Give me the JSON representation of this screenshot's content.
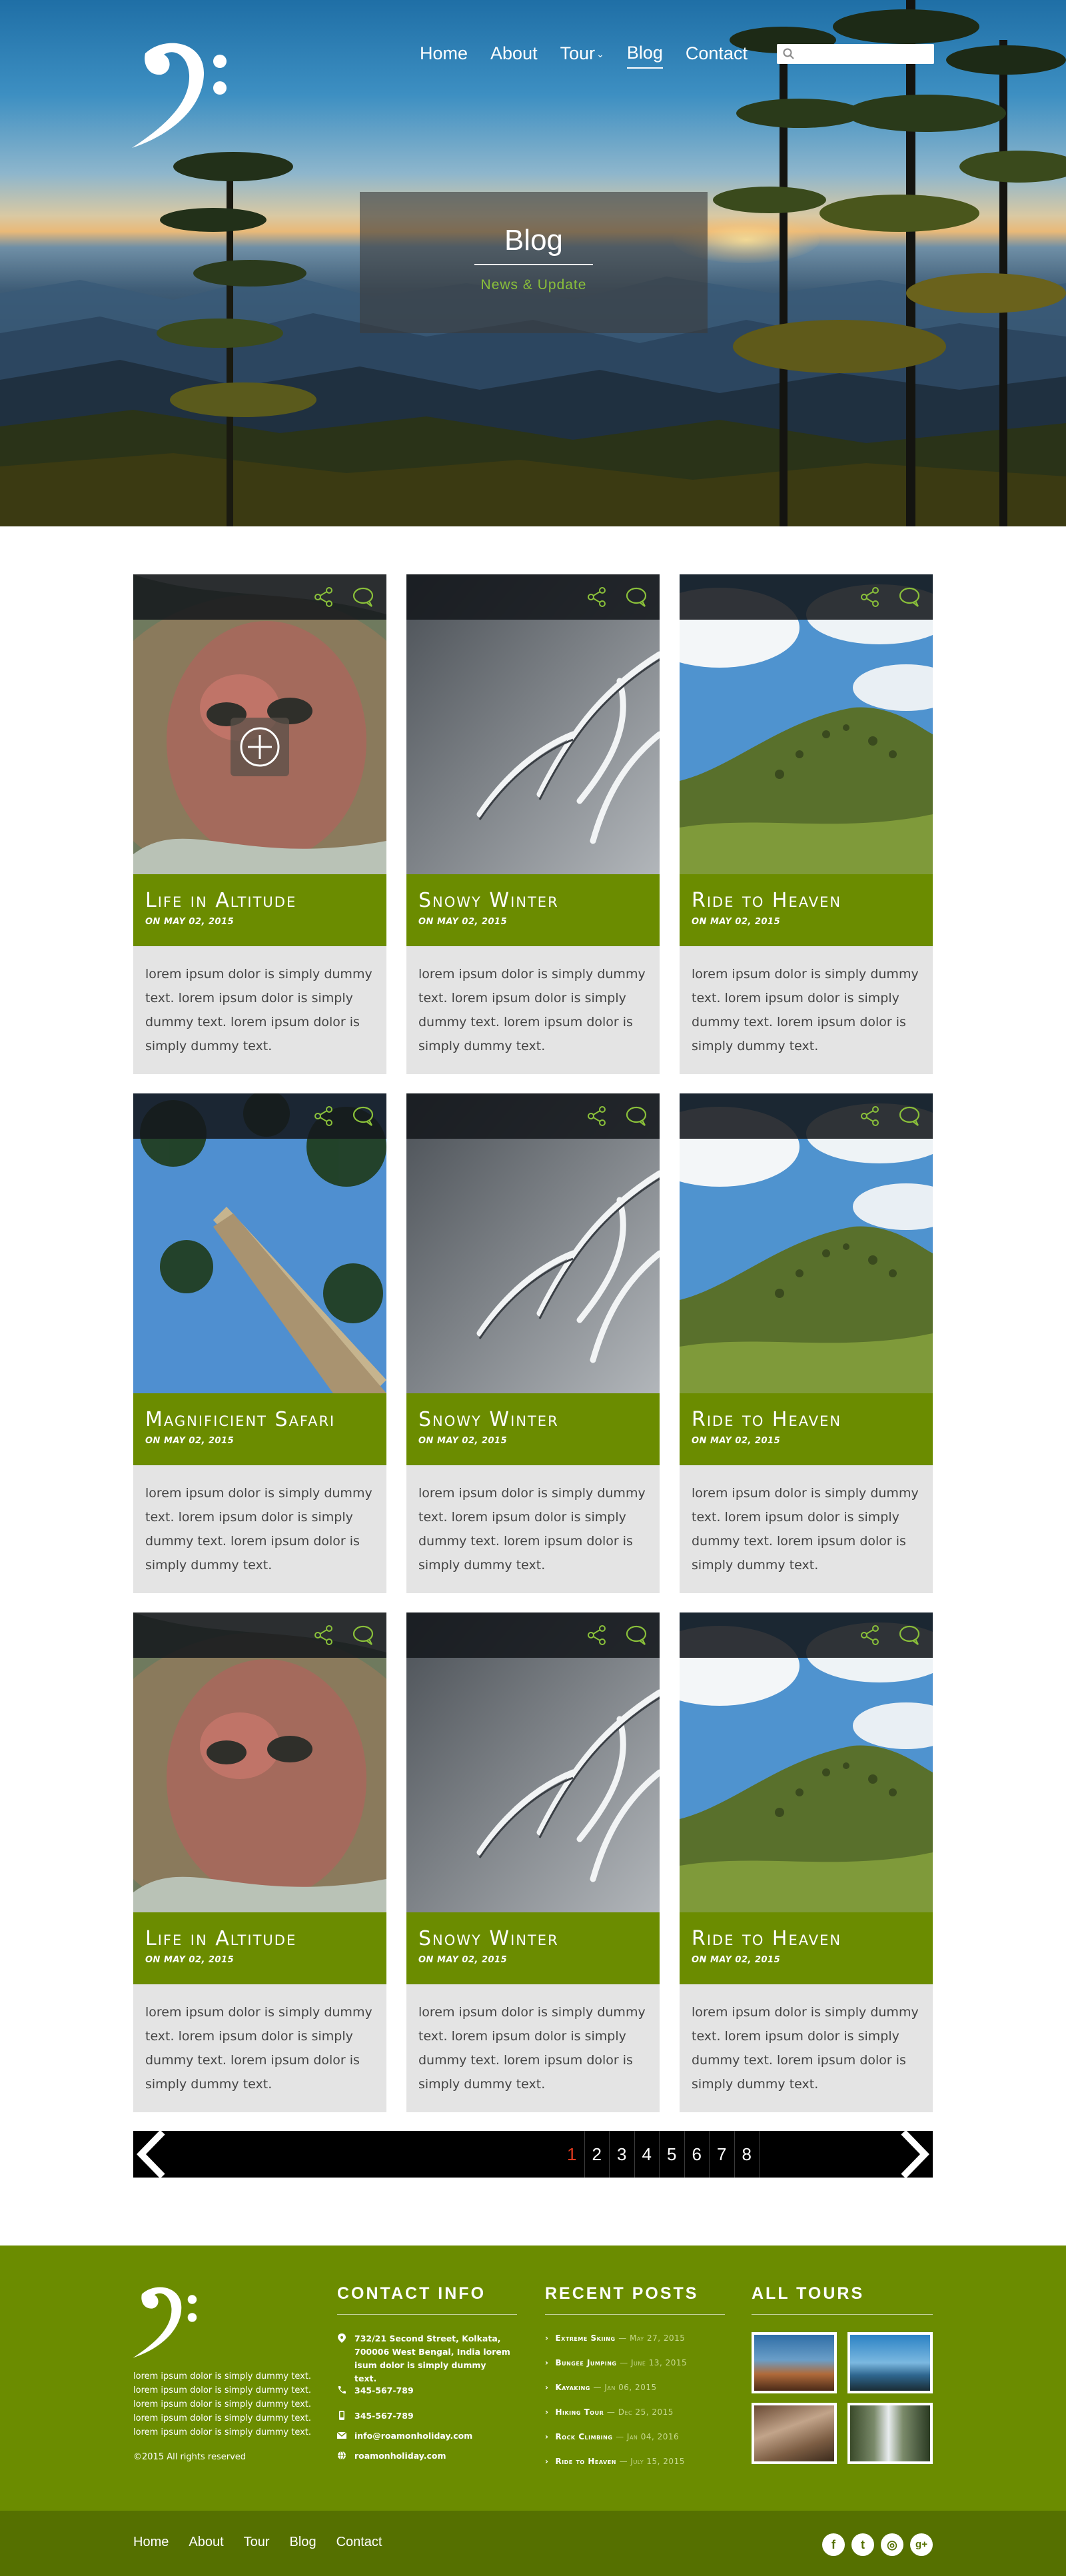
{
  "nav": {
    "items": [
      {
        "label": "Home"
      },
      {
        "label": "About"
      },
      {
        "label": "Tour"
      },
      {
        "label": "Blog"
      },
      {
        "label": "Contact"
      }
    ],
    "search_placeholder": ""
  },
  "hero": {
    "title": "Blog",
    "subtitle": "News & Update"
  },
  "posts": [
    {
      "title": "Life in Altitude",
      "date": "ON MAY 02, 2015",
      "excerpt": "lorem ipsum dolor is simply dummy text. lorem ipsum dolor is simply dummy text. lorem ipsum dolor is simply dummy text.",
      "image": "child-portrait"
    },
    {
      "title": "Snowy Winter",
      "date": "ON MAY 02, 2015",
      "excerpt": "lorem ipsum dolor is simply dummy text. lorem ipsum dolor is simply dummy text. lorem ipsum dolor is simply dummy text.",
      "image": "snowy-branches"
    },
    {
      "title": "Ride to Heaven",
      "date": "ON MAY 02, 2015",
      "excerpt": "lorem ipsum dolor is simply dummy text. lorem ipsum dolor is simply dummy text. lorem ipsum dolor is simply dummy text.",
      "image": "green-hill"
    },
    {
      "title": "Magnificient Safari",
      "date": "ON MAY 02, 2015",
      "excerpt": "lorem ipsum dolor is simply dummy text. lorem ipsum dolor is simply dummy text. lorem ipsum dolor is simply dummy text.",
      "image": "tree-trunk-sky"
    },
    {
      "title": "Snowy Winter",
      "date": "ON MAY 02, 2015",
      "excerpt": "lorem ipsum dolor is simply dummy text. lorem ipsum dolor is simply dummy text. lorem ipsum dolor is simply dummy text.",
      "image": "snowy-branches"
    },
    {
      "title": "Ride to Heaven",
      "date": "ON MAY 02, 2015",
      "excerpt": "lorem ipsum dolor is simply dummy text. lorem ipsum dolor is simply dummy text. lorem ipsum dolor is simply dummy text.",
      "image": "green-hill"
    },
    {
      "title": "Life in Altitude",
      "date": "ON MAY 02, 2015",
      "excerpt": "lorem ipsum dolor is simply dummy text. lorem ipsum dolor is simply dummy text. lorem ipsum dolor is simply dummy text.",
      "image": "child-portrait"
    },
    {
      "title": "Snowy Winter",
      "date": "ON MAY 02, 2015",
      "excerpt": "lorem ipsum dolor is simply dummy text. lorem ipsum dolor is simply dummy text. lorem ipsum dolor is simply dummy text.",
      "image": "snowy-branches"
    },
    {
      "title": "Ride to Heaven",
      "date": "ON MAY 02, 2015",
      "excerpt": "lorem ipsum dolor is simply dummy text. lorem ipsum dolor is simply dummy text. lorem ipsum dolor is simply dummy text.",
      "image": "green-hill"
    }
  ],
  "card_icons": {
    "share": "share-icon",
    "comment": "comment-icon",
    "zoom": "plus-circle-icon"
  },
  "pagination": {
    "pages": [
      "1",
      "2",
      "3",
      "4",
      "5",
      "6",
      "7",
      "8"
    ],
    "current": "1",
    "prev_icon": "chevron-left-icon",
    "next_icon": "chevron-right-icon"
  },
  "footer": {
    "about": "lorem ipsum dolor is simply dummy text. lorem ipsum dolor is simply dummy text. lorem ipsum dolor is simply dummy text. lorem ipsum dolor is simply dummy text. lorem ipsum dolor is simply dummy text.",
    "copyright": "©2015 All rights reserved",
    "contact": {
      "title": "CONTACT INFO",
      "address": "732/21 Second Street, Kolkata, 700006 West Bengal, India lorem isum dolor is simply dummy text.",
      "phone1": "345-567-789",
      "phone2": "345-567-789",
      "email": "info@roamonholiday.com",
      "web": "roamonholiday.com"
    },
    "recent_posts": {
      "title": "RECENT POSTS",
      "items": [
        {
          "label": "Extreme Skiing",
          "date": "— May 27, 2015"
        },
        {
          "label": "Bungee Jumping",
          "date": "— June 13, 2015"
        },
        {
          "label": "Kayaking",
          "date": "— Jan 06, 2015"
        },
        {
          "label": "Hiking Tour",
          "date": "— Dec 25, 2015"
        },
        {
          "label": "Rock Climbing",
          "date": "— Jan 04, 2016"
        },
        {
          "label": "Ride to Heaven",
          "date": "— July 15, 2015"
        }
      ]
    },
    "all_tours": {
      "title": "ALL TOURS"
    }
  },
  "bottom_nav": [
    {
      "label": "Home"
    },
    {
      "label": "About"
    },
    {
      "label": "Tour"
    },
    {
      "label": "Blog"
    },
    {
      "label": "Contact"
    }
  ],
  "social": [
    {
      "icon": "facebook-icon",
      "glyph": "f"
    },
    {
      "icon": "twitter-icon",
      "glyph": "t"
    },
    {
      "icon": "instagram-icon",
      "glyph": "◎"
    },
    {
      "icon": "google-plus-icon",
      "glyph": "g+"
    }
  ],
  "colors": {
    "accent_green": "#6b8c00",
    "dark_green": "#557000",
    "title_green": "#8ac03a",
    "active_page": "#e03a1e"
  }
}
